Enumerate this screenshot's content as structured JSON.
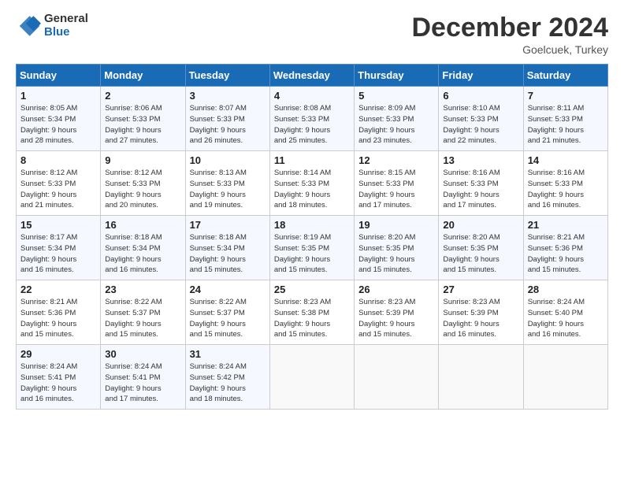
{
  "header": {
    "logo_line1": "General",
    "logo_line2": "Blue",
    "month_title": "December 2024",
    "subtitle": "Goelcuek, Turkey"
  },
  "weekdays": [
    "Sunday",
    "Monday",
    "Tuesday",
    "Wednesday",
    "Thursday",
    "Friday",
    "Saturday"
  ],
  "weeks": [
    [
      {
        "day": "1",
        "detail": "Sunrise: 8:05 AM\nSunset: 5:34 PM\nDaylight: 9 hours\nand 28 minutes."
      },
      {
        "day": "2",
        "detail": "Sunrise: 8:06 AM\nSunset: 5:33 PM\nDaylight: 9 hours\nand 27 minutes."
      },
      {
        "day": "3",
        "detail": "Sunrise: 8:07 AM\nSunset: 5:33 PM\nDaylight: 9 hours\nand 26 minutes."
      },
      {
        "day": "4",
        "detail": "Sunrise: 8:08 AM\nSunset: 5:33 PM\nDaylight: 9 hours\nand 25 minutes."
      },
      {
        "day": "5",
        "detail": "Sunrise: 8:09 AM\nSunset: 5:33 PM\nDaylight: 9 hours\nand 23 minutes."
      },
      {
        "day": "6",
        "detail": "Sunrise: 8:10 AM\nSunset: 5:33 PM\nDaylight: 9 hours\nand 22 minutes."
      },
      {
        "day": "7",
        "detail": "Sunrise: 8:11 AM\nSunset: 5:33 PM\nDaylight: 9 hours\nand 21 minutes."
      }
    ],
    [
      {
        "day": "8",
        "detail": "Sunrise: 8:12 AM\nSunset: 5:33 PM\nDaylight: 9 hours\nand 21 minutes."
      },
      {
        "day": "9",
        "detail": "Sunrise: 8:12 AM\nSunset: 5:33 PM\nDaylight: 9 hours\nand 20 minutes."
      },
      {
        "day": "10",
        "detail": "Sunrise: 8:13 AM\nSunset: 5:33 PM\nDaylight: 9 hours\nand 19 minutes."
      },
      {
        "day": "11",
        "detail": "Sunrise: 8:14 AM\nSunset: 5:33 PM\nDaylight: 9 hours\nand 18 minutes."
      },
      {
        "day": "12",
        "detail": "Sunrise: 8:15 AM\nSunset: 5:33 PM\nDaylight: 9 hours\nand 17 minutes."
      },
      {
        "day": "13",
        "detail": "Sunrise: 8:16 AM\nSunset: 5:33 PM\nDaylight: 9 hours\nand 17 minutes."
      },
      {
        "day": "14",
        "detail": "Sunrise: 8:16 AM\nSunset: 5:33 PM\nDaylight: 9 hours\nand 16 minutes."
      }
    ],
    [
      {
        "day": "15",
        "detail": "Sunrise: 8:17 AM\nSunset: 5:34 PM\nDaylight: 9 hours\nand 16 minutes."
      },
      {
        "day": "16",
        "detail": "Sunrise: 8:18 AM\nSunset: 5:34 PM\nDaylight: 9 hours\nand 16 minutes."
      },
      {
        "day": "17",
        "detail": "Sunrise: 8:18 AM\nSunset: 5:34 PM\nDaylight: 9 hours\nand 15 minutes."
      },
      {
        "day": "18",
        "detail": "Sunrise: 8:19 AM\nSunset: 5:35 PM\nDaylight: 9 hours\nand 15 minutes."
      },
      {
        "day": "19",
        "detail": "Sunrise: 8:20 AM\nSunset: 5:35 PM\nDaylight: 9 hours\nand 15 minutes."
      },
      {
        "day": "20",
        "detail": "Sunrise: 8:20 AM\nSunset: 5:35 PM\nDaylight: 9 hours\nand 15 minutes."
      },
      {
        "day": "21",
        "detail": "Sunrise: 8:21 AM\nSunset: 5:36 PM\nDaylight: 9 hours\nand 15 minutes."
      }
    ],
    [
      {
        "day": "22",
        "detail": "Sunrise: 8:21 AM\nSunset: 5:36 PM\nDaylight: 9 hours\nand 15 minutes."
      },
      {
        "day": "23",
        "detail": "Sunrise: 8:22 AM\nSunset: 5:37 PM\nDaylight: 9 hours\nand 15 minutes."
      },
      {
        "day": "24",
        "detail": "Sunrise: 8:22 AM\nSunset: 5:37 PM\nDaylight: 9 hours\nand 15 minutes."
      },
      {
        "day": "25",
        "detail": "Sunrise: 8:23 AM\nSunset: 5:38 PM\nDaylight: 9 hours\nand 15 minutes."
      },
      {
        "day": "26",
        "detail": "Sunrise: 8:23 AM\nSunset: 5:39 PM\nDaylight: 9 hours\nand 15 minutes."
      },
      {
        "day": "27",
        "detail": "Sunrise: 8:23 AM\nSunset: 5:39 PM\nDaylight: 9 hours\nand 16 minutes."
      },
      {
        "day": "28",
        "detail": "Sunrise: 8:24 AM\nSunset: 5:40 PM\nDaylight: 9 hours\nand 16 minutes."
      }
    ],
    [
      {
        "day": "29",
        "detail": "Sunrise: 8:24 AM\nSunset: 5:41 PM\nDaylight: 9 hours\nand 16 minutes."
      },
      {
        "day": "30",
        "detail": "Sunrise: 8:24 AM\nSunset: 5:41 PM\nDaylight: 9 hours\nand 17 minutes."
      },
      {
        "day": "31",
        "detail": "Sunrise: 8:24 AM\nSunset: 5:42 PM\nDaylight: 9 hours\nand 18 minutes."
      },
      {
        "day": "",
        "detail": ""
      },
      {
        "day": "",
        "detail": ""
      },
      {
        "day": "",
        "detail": ""
      },
      {
        "day": "",
        "detail": ""
      }
    ]
  ]
}
